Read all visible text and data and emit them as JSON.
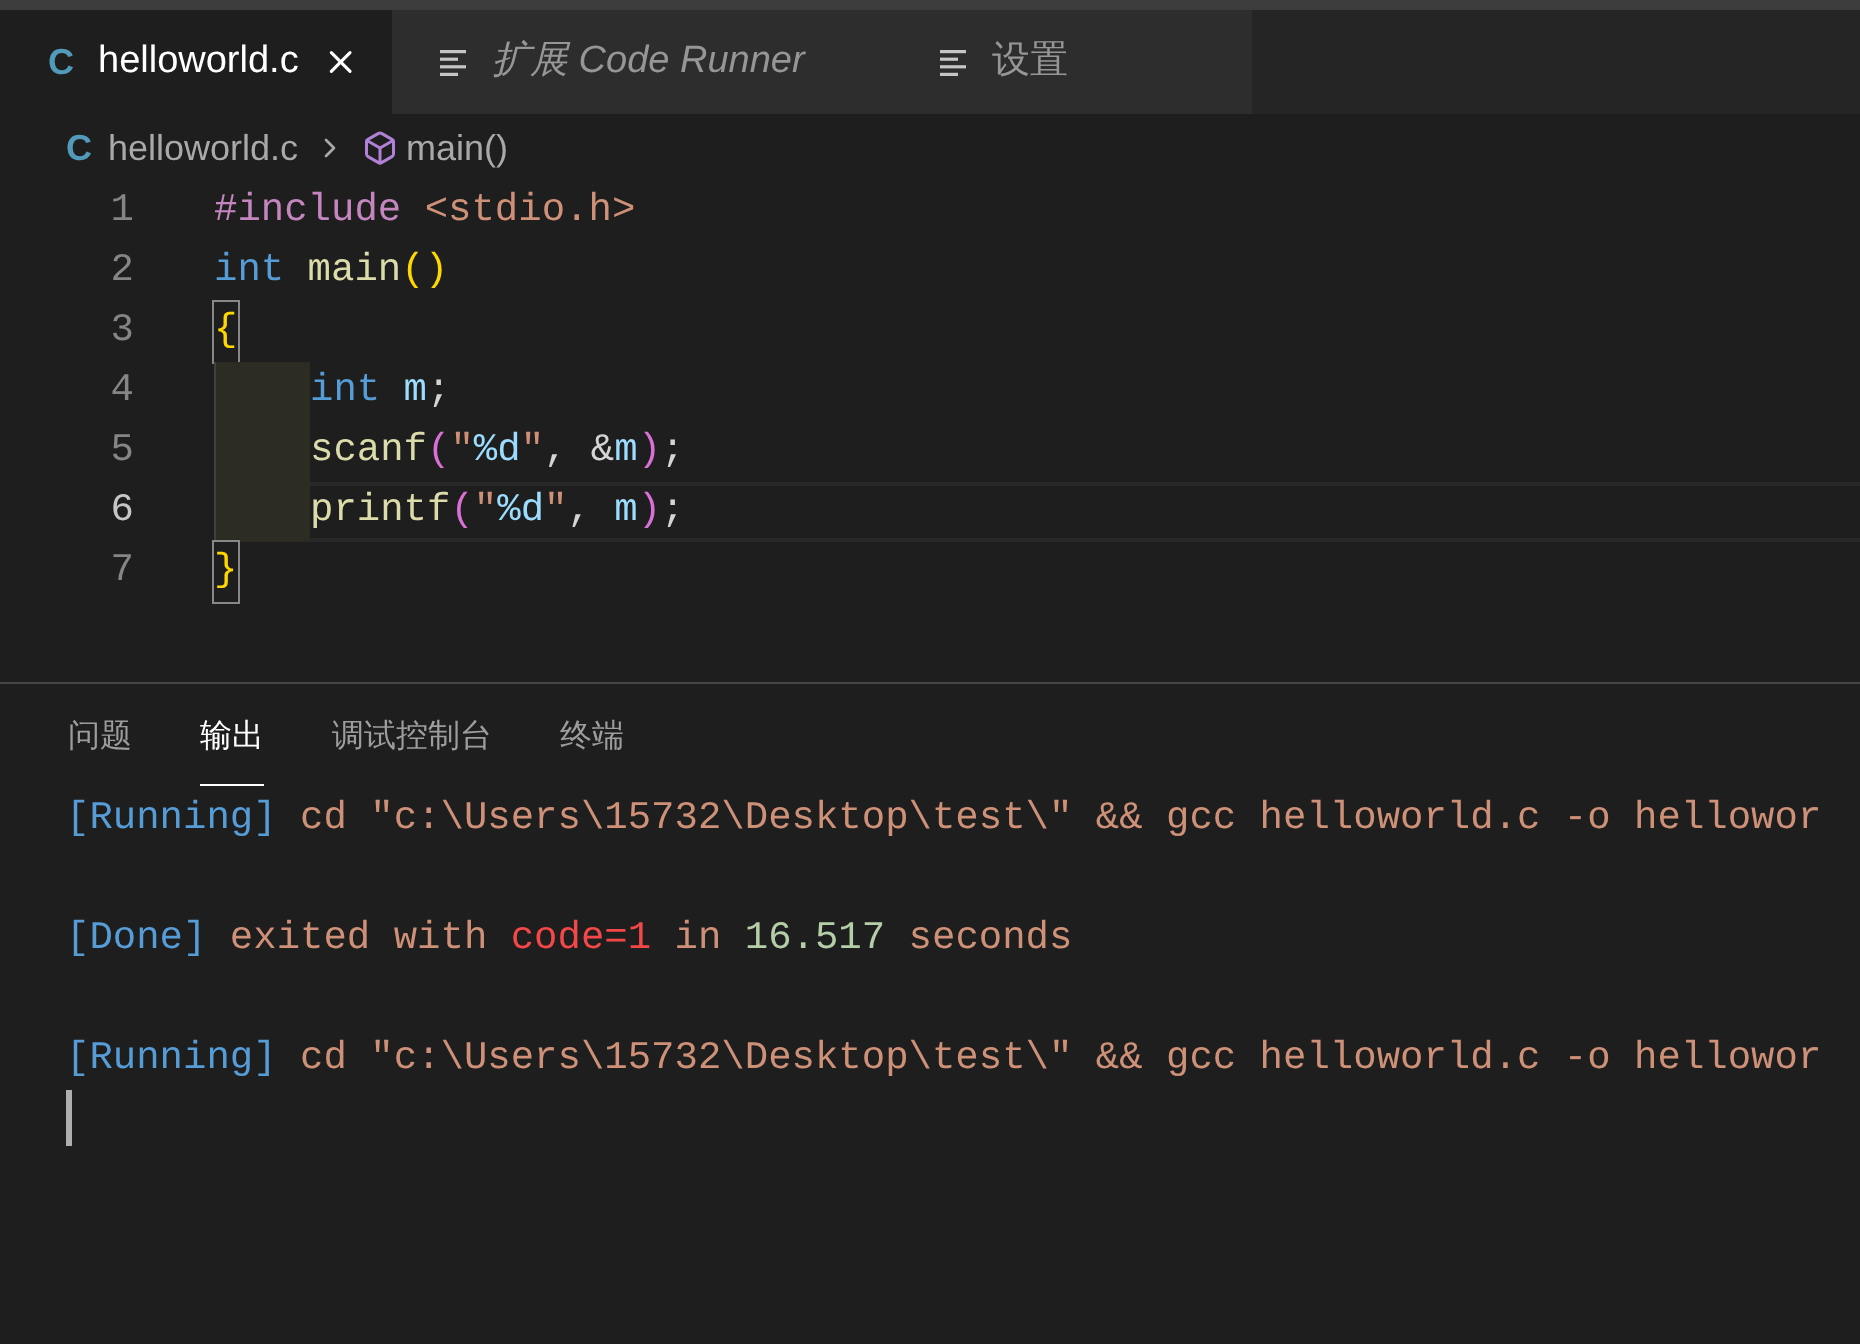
{
  "tabs": [
    {
      "kind": "c-file",
      "icon_text": "C",
      "label": "helloworld.c",
      "selected": true,
      "closable": true,
      "italic": false
    },
    {
      "kind": "preview",
      "label": "扩展 Code Runner",
      "selected": false,
      "closable": false,
      "italic": true
    },
    {
      "kind": "preview",
      "label": "设置",
      "selected": false,
      "closable": false,
      "italic": false
    }
  ],
  "breadcrumb": {
    "file_icon_text": "C",
    "file": "helloworld.c",
    "symbol": "main()"
  },
  "code_lines": [
    {
      "number": "1",
      "current": false,
      "indented": false,
      "tokens": [
        {
          "text": "#include",
          "kind": "directive"
        },
        {
          "text": " <stdio.h>",
          "kind": "include"
        }
      ]
    },
    {
      "number": "2",
      "current": false,
      "indented": false,
      "tokens": [
        {
          "text": "int",
          "kind": "keyword"
        },
        {
          "text": " main",
          "kind": "function"
        },
        {
          "text": "()",
          "kind": "bracket1"
        }
      ]
    },
    {
      "number": "3",
      "current": false,
      "indented": false,
      "tokens": [
        {
          "text": "{",
          "kind": "bracket1",
          "matched": true
        }
      ]
    },
    {
      "number": "4",
      "current": false,
      "indented": true,
      "tokens": [
        {
          "text": "int",
          "kind": "keyword"
        },
        {
          "text": " m",
          "kind": "variable"
        },
        {
          "text": ";",
          "kind": "plain"
        }
      ]
    },
    {
      "number": "5",
      "current": false,
      "indented": true,
      "tokens": [
        {
          "text": "scanf",
          "kind": "function"
        },
        {
          "text": "(",
          "kind": "bracket2"
        },
        {
          "text": "\"",
          "kind": "string"
        },
        {
          "text": "%d",
          "kind": "format"
        },
        {
          "text": "\"",
          "kind": "string"
        },
        {
          "text": ", &",
          "kind": "plain"
        },
        {
          "text": "m",
          "kind": "variable"
        },
        {
          "text": ")",
          "kind": "bracket2"
        },
        {
          "text": ";",
          "kind": "plain"
        }
      ]
    },
    {
      "number": "6",
      "current": true,
      "indented": true,
      "tokens": [
        {
          "text": "printf",
          "kind": "function"
        },
        {
          "text": "(",
          "kind": "bracket2"
        },
        {
          "text": "\"",
          "kind": "string"
        },
        {
          "text": "%d",
          "kind": "format"
        },
        {
          "text": "\"",
          "kind": "string"
        },
        {
          "text": ",",
          "kind": "plain"
        },
        {
          "text": " m",
          "kind": "variable"
        },
        {
          "text": ")",
          "kind": "bracket2"
        },
        {
          "text": ";",
          "kind": "plain"
        }
      ]
    },
    {
      "number": "7",
      "current": false,
      "indented": false,
      "tokens": [
        {
          "text": "}",
          "kind": "bracket1",
          "matched": true
        }
      ]
    }
  ],
  "panel_tabs": [
    {
      "label": "问题",
      "selected": false
    },
    {
      "label": "输出",
      "selected": true
    },
    {
      "label": "调试控制台",
      "selected": false
    },
    {
      "label": "终端",
      "selected": false
    }
  ],
  "output_lines": [
    [
      {
        "text": "[Running]",
        "kind": "tag"
      },
      {
        "text": " cd \"c:\\Users\\15732\\Desktop\\test\\\" && gcc helloworld.c -o hellowor",
        "kind": "text"
      }
    ],
    [
      {
        "text": "[Done]",
        "kind": "tag"
      },
      {
        "text": " exited with ",
        "kind": "text"
      },
      {
        "text": "code=1",
        "kind": "error"
      },
      {
        "text": " in ",
        "kind": "text"
      },
      {
        "text": "16.517",
        "kind": "number"
      },
      {
        "text": " seconds",
        "kind": "text"
      }
    ],
    [
      {
        "text": "[Running]",
        "kind": "tag"
      },
      {
        "text": " cd \"c:\\Users\\15732\\Desktop\\test\\\" && gcc helloworld.c -o hellowor",
        "kind": "text"
      }
    ]
  ],
  "output_cursor": true
}
